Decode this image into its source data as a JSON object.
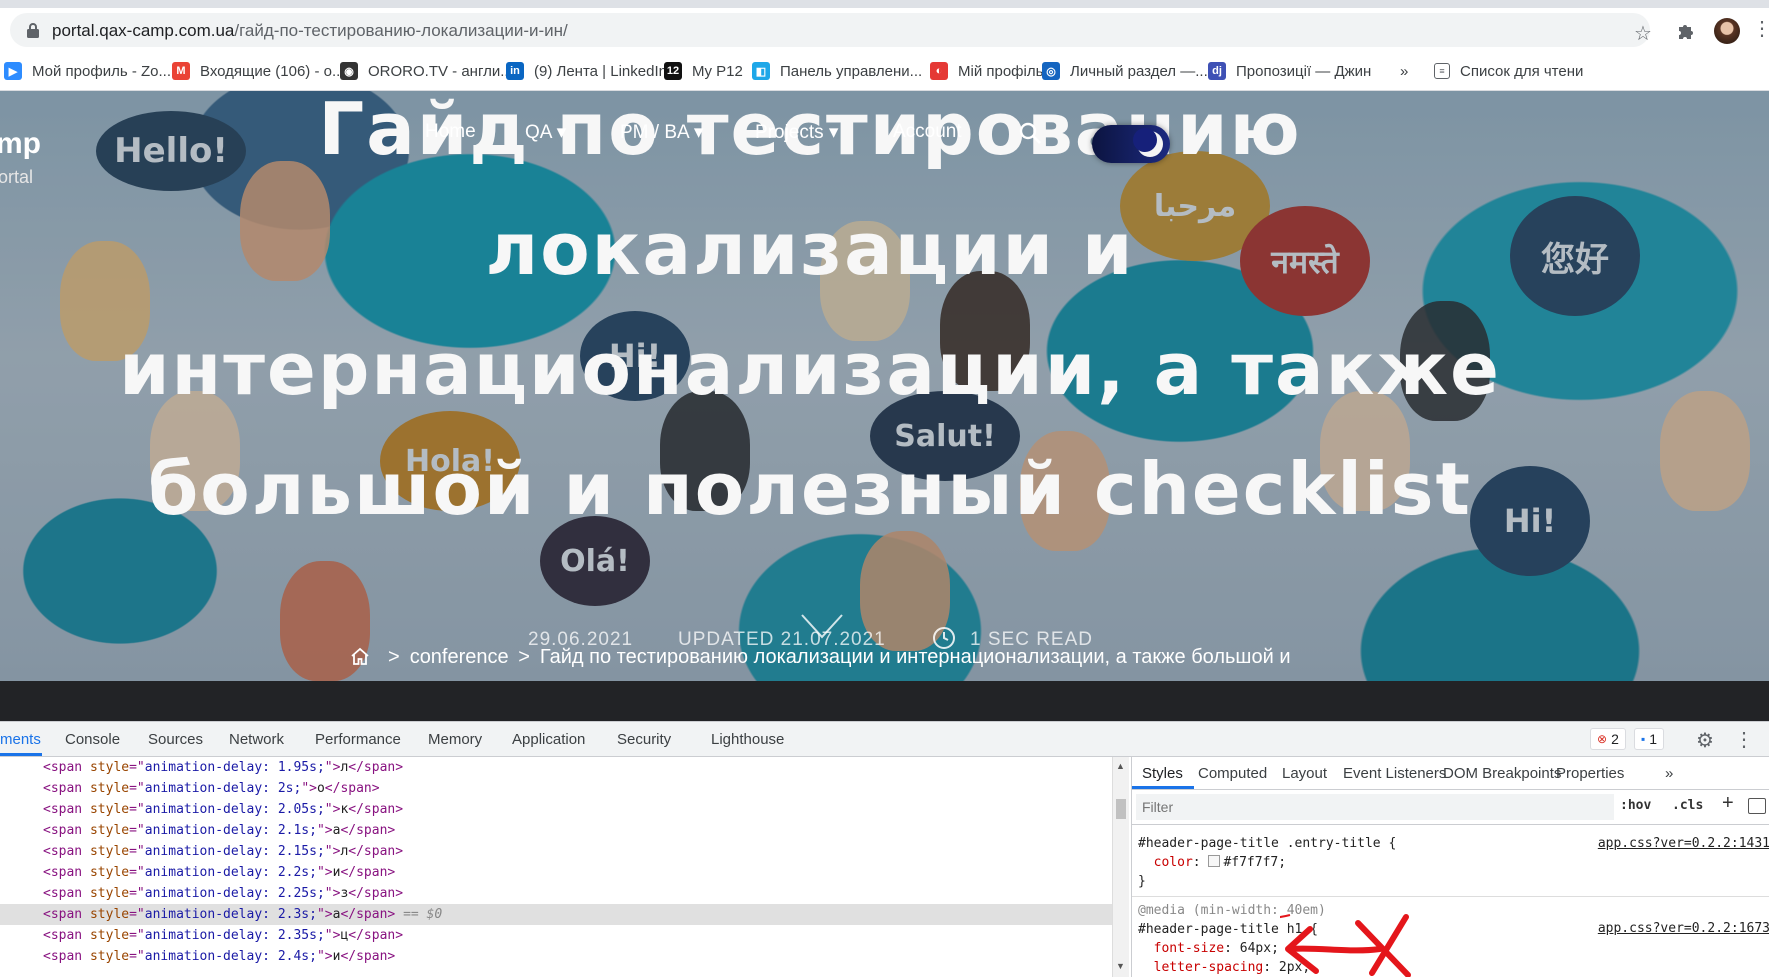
{
  "browser": {
    "url_domain": "portal.qax-camp.com.ua",
    "url_path": "/гайд-по-тестированию-локализации-и-ин/",
    "bookmarks": [
      {
        "label": "Мой профиль - Zo...",
        "icon": "zoom-icon",
        "color": "#2d8cff"
      },
      {
        "label": "Входящие (106) - о...",
        "icon": "gmail-icon",
        "color": "#ea4335"
      },
      {
        "label": "ORORO.TV - англи...",
        "icon": "ororo-icon",
        "color": "#333333"
      },
      {
        "label": "(9) Лента | LinkedIn",
        "icon": "linkedin-icon",
        "color": "#0a66c2"
      },
      {
        "label": "My P12",
        "icon": "p12-icon",
        "color": "#111111"
      },
      {
        "label": "Панель управлени...",
        "icon": "panel-icon",
        "color": "#1ea7e8"
      },
      {
        "label": "Мій профіль",
        "icon": "profile-icon",
        "color": "#e53935"
      },
      {
        "label": "Личный раздел —...",
        "icon": "personal-icon",
        "color": "#1565c0"
      },
      {
        "label": "Пропозиції — Джин",
        "icon": "djinni-icon",
        "color": "#3f51b5"
      }
    ],
    "bookmarks_overflow": "»",
    "reading_list": "Список для чтени"
  },
  "site": {
    "logo": "mp",
    "tagline": "ortal",
    "nav": [
      {
        "label": "Home"
      },
      {
        "label": "QA ▾"
      },
      {
        "label": "PM / BA ▾"
      },
      {
        "label": "Projects ▾"
      },
      {
        "label": "Account"
      }
    ]
  },
  "article": {
    "title": "Гайд по тестированию локализации и интернационализации, а также большой и полезный checklist",
    "date": "29.06.2021",
    "updated": "UPDATED 21.07.2021",
    "read_time": "1 SEC READ",
    "hero_bubbles": [
      "Hello!",
      "مرحبا",
      "नमस्ते",
      "您好",
      "Hi!",
      "Salut!",
      "Hola!",
      "Olá!",
      "Hi!"
    ]
  },
  "breadcrumb": {
    "category": "conference",
    "current": "Гайд по тестированию локализации и интернационализации, а также большой и полезный checklist"
  },
  "devtools": {
    "tabs": [
      "ments",
      "Console",
      "Sources",
      "Network",
      "Performance",
      "Memory",
      "Application",
      "Security",
      "Lighthouse"
    ],
    "error_count": "2",
    "message_count": "1",
    "elements": [
      {
        "delay": "1.95s;",
        "char": "л"
      },
      {
        "delay": "2s;",
        "char": "о"
      },
      {
        "delay": "2.05s;",
        "char": "к"
      },
      {
        "delay": "2.1s;",
        "char": "а"
      },
      {
        "delay": "2.15s;",
        "char": "л"
      },
      {
        "delay": "2.2s;",
        "char": "и"
      },
      {
        "delay": "2.25s;",
        "char": "з"
      },
      {
        "delay": "2.3s;",
        "char": "а",
        "selected": true
      },
      {
        "delay": "2.35s;",
        "char": "ц"
      },
      {
        "delay": "2.4s;",
        "char": "и"
      }
    ],
    "selected_ref": "== $0",
    "styles_tabs": [
      "Styles",
      "Computed",
      "Layout",
      "Event Listeners",
      "DOM Breakpoints",
      "Properties",
      "»"
    ],
    "filter_placeholder": "Filter",
    "hov": ":hov",
    "cls": ".cls",
    "rules": [
      {
        "selector": "#header-page-title .entry-title {",
        "source": "app.css?ver=0.2.2:1431",
        "props": [
          {
            "name": "color",
            "value": "#f7f7f7;",
            "swatch": true
          }
        ],
        "close": "}"
      },
      {
        "media": "@media (min-width: 40em)",
        "selector": "#header-page-title h1 {",
        "source": "app.css?ver=0.2.2:1673",
        "props": [
          {
            "name": "font-size",
            "value": "64px;"
          },
          {
            "name": "letter-spacing",
            "value": "2px;"
          }
        ],
        "close": "}"
      }
    ]
  }
}
